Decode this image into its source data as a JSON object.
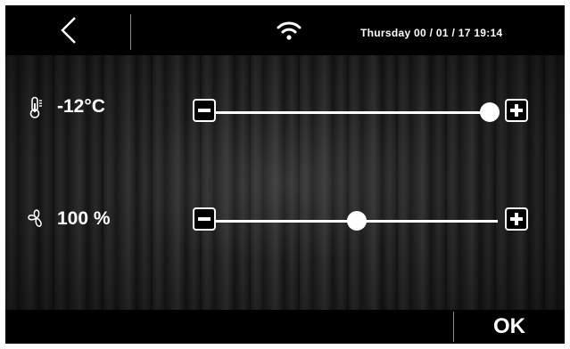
{
  "header": {
    "back_icon": "chevron-left-icon",
    "wifi_icon": "wifi-icon",
    "datetime": "Thursday 00 / 01 / 17  19:14"
  },
  "params": [
    {
      "icon": "thermometer-icon",
      "value": "-12°C",
      "level": 0.97
    },
    {
      "icon": "fan-icon",
      "value": "100 %",
      "level": 0.5
    }
  ],
  "controls": {
    "decrease_icon": "minus-icon",
    "increase_icon": "plus-icon"
  },
  "footer": {
    "ok_label": "OK"
  },
  "colors": {
    "background": "#000000",
    "text": "#ffffff",
    "divider": "#8a8a8a"
  }
}
